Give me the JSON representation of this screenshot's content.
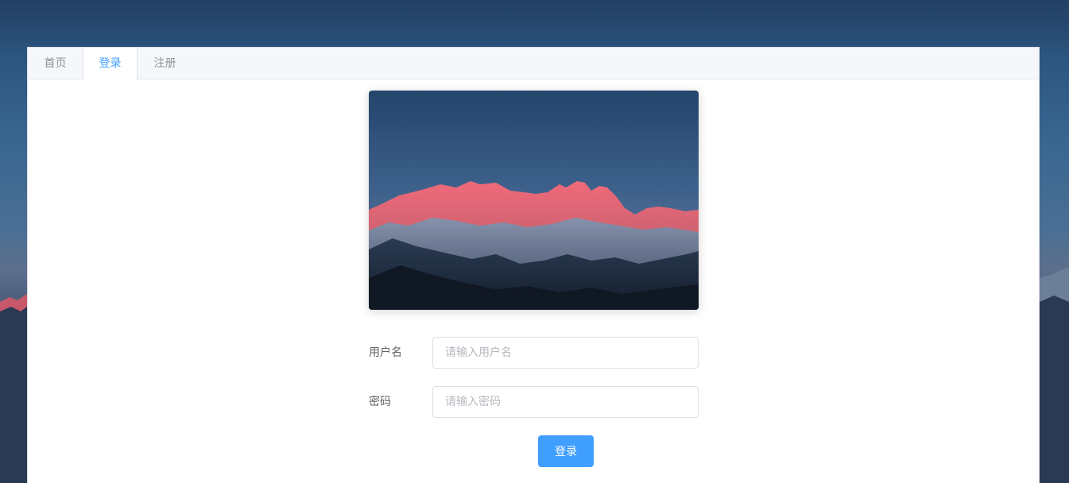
{
  "tabs": [
    {
      "label": "首页",
      "active": false
    },
    {
      "label": "登录",
      "active": true
    },
    {
      "label": "注册",
      "active": false
    }
  ],
  "form": {
    "username_label": "用户名",
    "username_placeholder": "请输入用户名",
    "username_value": "",
    "password_label": "密码",
    "password_placeholder": "请输入密码",
    "password_value": "",
    "submit_label": "登录"
  },
  "colors": {
    "accent": "#409eff",
    "tab_bar": "#f5f7fa",
    "border": "#dcdfe6"
  },
  "images": {
    "hero": "mountain-alpenglow-photo",
    "background": "mountain-background-photo"
  }
}
